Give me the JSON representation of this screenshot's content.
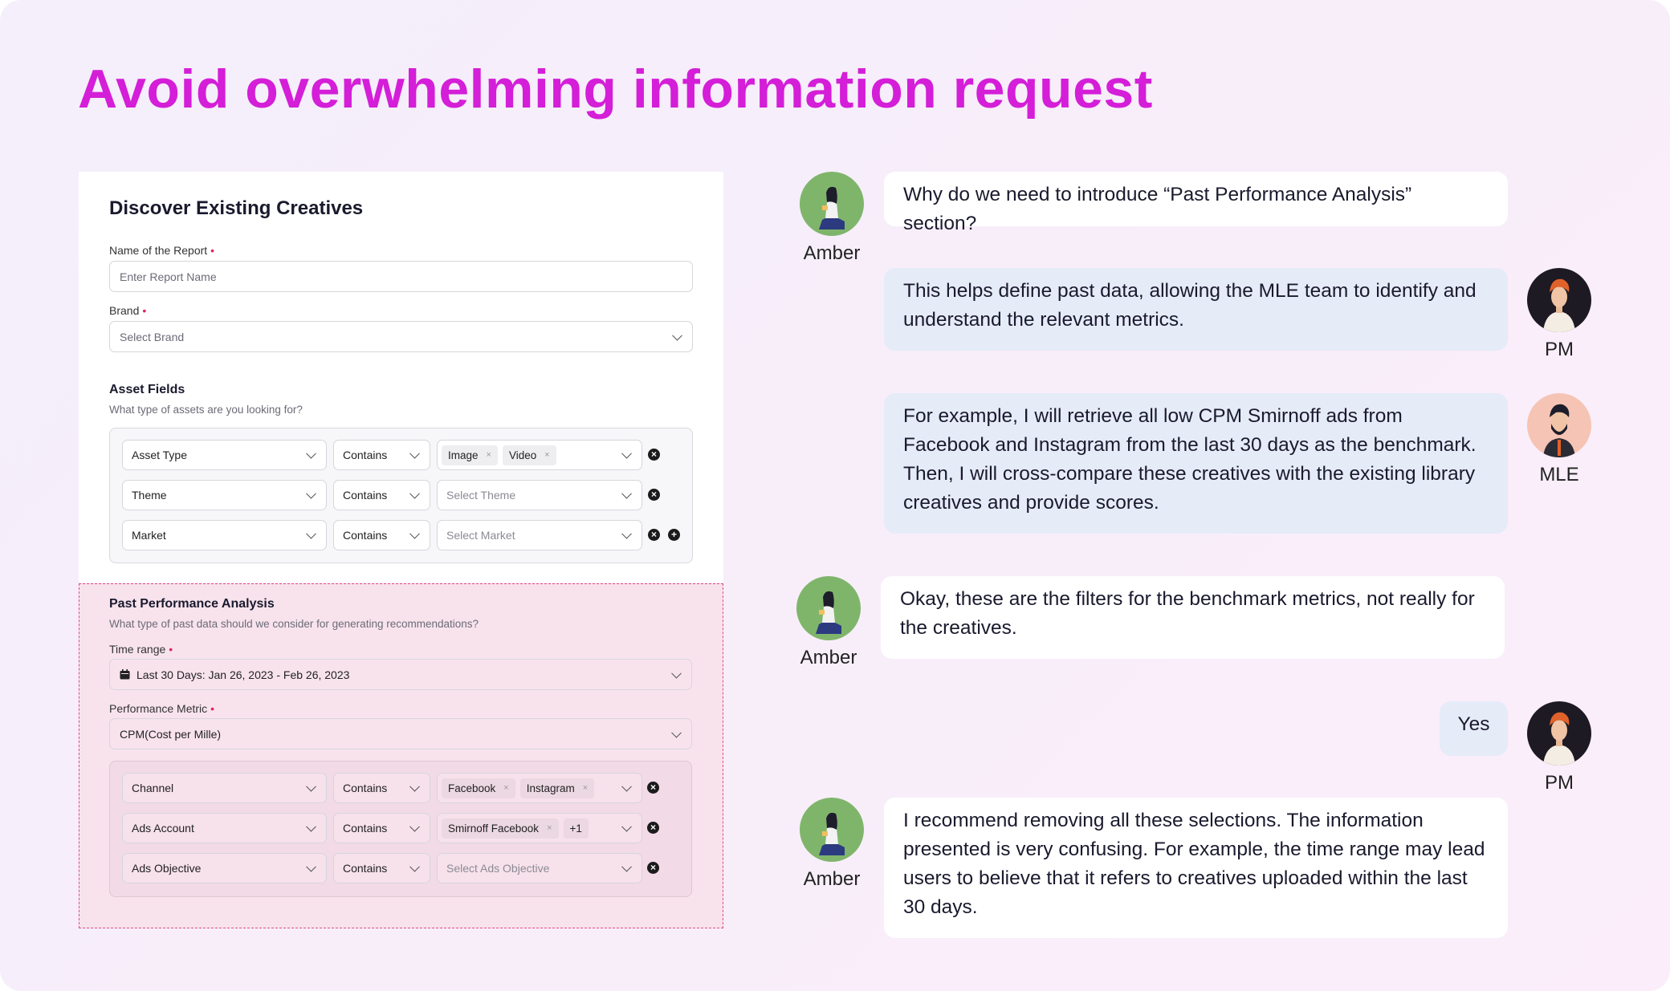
{
  "headline": "Avoid overwhelming information request",
  "form": {
    "title": "Discover Existing Creatives",
    "report_name_label": "Name of the Report",
    "report_name_placeholder": "Enter Report Name",
    "brand_label": "Brand",
    "brand_placeholder": "Select Brand",
    "required_mark": "•",
    "asset_fields_title": "Asset Fields",
    "asset_fields_subtitle": "What type of assets are you looking for?",
    "asset_rows": [
      {
        "field": "Asset Type",
        "operator": "Contains",
        "values": [
          "Image",
          "Video"
        ],
        "placeholder": ""
      },
      {
        "field": "Theme",
        "operator": "Contains",
        "values": [],
        "placeholder": "Select Theme"
      },
      {
        "field": "Market",
        "operator": "Contains",
        "values": [],
        "placeholder": "Select Market"
      }
    ],
    "past": {
      "title": "Past Performance Analysis",
      "subtitle": "What type of past data should we consider for generating recommendations?",
      "time_range_label": "Time range",
      "time_range_value": "Last 30 Days: Jan 26, 2023 - Feb 26, 2023",
      "metric_label": "Performance Metric",
      "metric_value": "CPM(Cost per Mille)",
      "rows": [
        {
          "field": "Channel",
          "operator": "Contains",
          "values": [
            "Facebook",
            "Instagram"
          ],
          "placeholder": ""
        },
        {
          "field": "Ads Account",
          "operator": "Contains",
          "values": [
            "Smirnoff Facebook"
          ],
          "extra": "+1",
          "placeholder": ""
        },
        {
          "field": "Ads Objective",
          "operator": "Contains",
          "values": [],
          "placeholder": "Select Ads Objective"
        }
      ]
    }
  },
  "chat": [
    {
      "speaker": "Amber",
      "text": "Why do we need to introduce “Past Performance Analysis” section?"
    },
    {
      "speaker": "PM",
      "text": "This helps define past data, allowing the MLE team to identify and understand the relevant metrics."
    },
    {
      "speaker": "MLE",
      "text": "For example, I will retrieve all low CPM Smirnoff ads from Facebook and Instagram from the last 30 days as the benchmark. Then, I will cross-compare these creatives with the existing library creatives and provide scores."
    },
    {
      "speaker": "Amber",
      "text": "Okay, these are the filters for the benchmark metrics, not really for the creatives."
    },
    {
      "speaker": "PM",
      "text": "Yes"
    },
    {
      "speaker": "Amber",
      "text": "I recommend removing all these selections. The information presented is very confusing. For example, the time range may lead users to believe that it refers to creatives uploaded within the last 30 days."
    }
  ],
  "colors": {
    "headline": "#d41ed8",
    "required": "#e0245e",
    "past_bg": "#f8e3ed",
    "past_border": "#e24b7f",
    "bubble_blue": "#e6ebf8"
  }
}
